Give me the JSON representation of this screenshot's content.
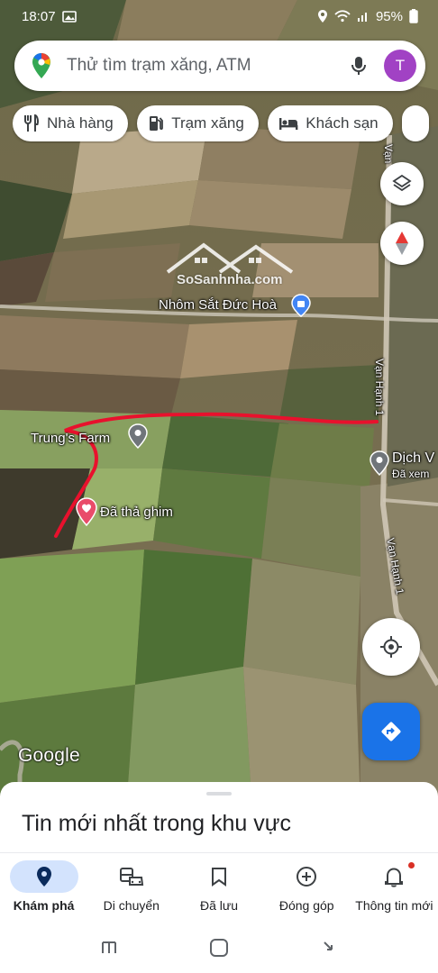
{
  "status_bar": {
    "time": "18:07",
    "battery": "95%"
  },
  "search": {
    "placeholder": "Thử tìm trạm xăng, ATM",
    "avatar_letter": "T"
  },
  "chips": [
    {
      "label": "Nhà hàng",
      "icon": "restaurant-icon"
    },
    {
      "label": "Trạm xăng",
      "icon": "gas-station-icon"
    },
    {
      "label": "Khách sạn",
      "icon": "hotel-icon"
    }
  ],
  "map": {
    "labels": {
      "nhom_sat": "Nhôm Sắt Đức Hoà",
      "trungs_farm": "Trung's Farm",
      "pin": "Đã thả ghim",
      "dich_vu": "Dịch V",
      "dich_vu_sub": "Đã xem",
      "road_1": "Vạn Hạnh 1",
      "road_2": "Vạn Hạnh 1",
      "road_top": "Vạn",
      "watermark": "SoSanhnha.com"
    },
    "google_logo": "Google",
    "route_color": "#e8112d",
    "pin_color": "#e94c6a"
  },
  "sheet": {
    "title": "Tin mới nhất trong khu vực"
  },
  "nav": [
    {
      "label": "Khám phá",
      "icon": "explore-pin-icon",
      "active": true
    },
    {
      "label": "Di chuyển",
      "icon": "commute-icon",
      "active": false
    },
    {
      "label": "Đã lưu",
      "icon": "bookmark-icon",
      "active": false
    },
    {
      "label": "Đóng góp",
      "icon": "add-circle-icon",
      "active": false
    },
    {
      "label": "Thông tin mới",
      "icon": "bell-icon",
      "active": false
    }
  ]
}
